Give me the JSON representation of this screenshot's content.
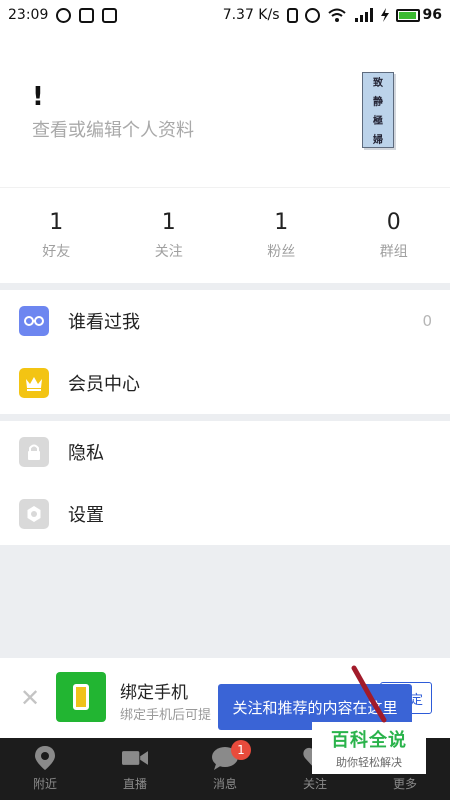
{
  "status_bar": {
    "time": "23:09",
    "speed": "7.37 K/s",
    "battery": "96",
    "icons": [
      "location-icon",
      "image-icon",
      "notification-icon",
      "vibrate-icon",
      "alarm-icon",
      "wifi-icon",
      "signal-icon",
      "charging-icon"
    ]
  },
  "profile": {
    "name": "!",
    "edit_hint": "查看或编辑个人资料",
    "avatar_chars": [
      "致",
      "静",
      "極",
      "婦"
    ]
  },
  "stats": [
    {
      "value": "1",
      "label": "好友"
    },
    {
      "value": "1",
      "label": "关注"
    },
    {
      "value": "1",
      "label": "粉丝"
    },
    {
      "value": "0",
      "label": "群组"
    }
  ],
  "menu_group_1": [
    {
      "label": "谁看过我",
      "value": "0",
      "icon": "glasses-icon",
      "color": "#6d86f0"
    },
    {
      "label": "会员中心",
      "value": "",
      "icon": "crown-icon",
      "color": "#f3c413"
    }
  ],
  "menu_group_2": [
    {
      "label": "隐私",
      "value": "",
      "icon": "lock-icon",
      "color": "#d9d9d9"
    },
    {
      "label": "设置",
      "value": "",
      "icon": "settings-icon",
      "color": "#d9d9d9"
    }
  ],
  "banner": {
    "title": "绑定手机",
    "subtitle": "绑定手机后可提",
    "button_label": "定",
    "icon": "phone-icon"
  },
  "tooltip": {
    "text": "关注和推荐的内容在这里"
  },
  "tabbar": [
    {
      "label": "附近",
      "icon": "location-pin-icon"
    },
    {
      "label": "直播",
      "icon": "video-icon"
    },
    {
      "label": "消息",
      "icon": "chat-bubble-icon",
      "badge": "1"
    },
    {
      "label": "关注",
      "icon": "heart-icon"
    },
    {
      "label": "更多",
      "icon": "more-icon"
    }
  ],
  "watermark": {
    "title": "百科全说",
    "subtitle": "助你轻松解决"
  },
  "colors": {
    "accent_blue": "#3a64d6",
    "badge_red": "#e84b3c",
    "tab_bg": "#1c1c1c",
    "brand_green": "#2ab34b"
  }
}
